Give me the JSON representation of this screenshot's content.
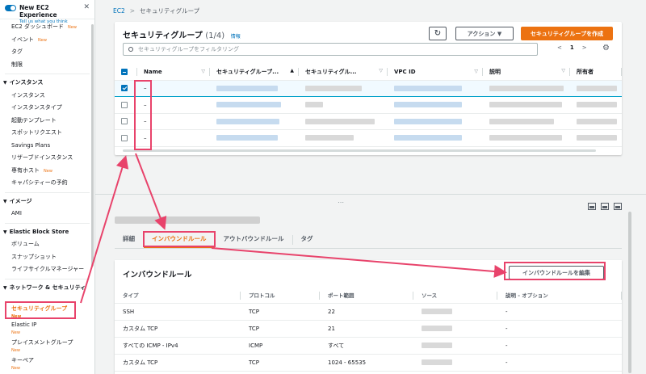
{
  "sidebar": {
    "experience_title": "New EC2 Experience",
    "experience_sub": "Tell us what you think",
    "close_glyph": "✕",
    "top_items": [
      {
        "label": "EC2 ダッシュボード",
        "badge": "New"
      },
      {
        "label": "イベント",
        "badge": "New"
      },
      {
        "label": "タグ",
        "badge": ""
      },
      {
        "label": "制限",
        "badge": ""
      }
    ],
    "sec_instances": "インスタンス",
    "instance_items": [
      {
        "label": "インスタンス",
        "badge": ""
      },
      {
        "label": "インスタンスタイプ",
        "badge": ""
      },
      {
        "label": "起動テンプレート",
        "badge": ""
      },
      {
        "label": "スポットリクエスト",
        "badge": ""
      },
      {
        "label": "Savings Plans",
        "badge": ""
      },
      {
        "label": "リザーブドインスタンス",
        "badge": ""
      },
      {
        "label": "専有ホスト",
        "badge": "New"
      },
      {
        "label": "キャパシティーの予約",
        "badge": ""
      }
    ],
    "sec_images": "イメージ",
    "image_items": [
      {
        "label": "AMI",
        "badge": ""
      }
    ],
    "sec_ebs": "Elastic Block Store",
    "ebs_items": [
      {
        "label": "ボリューム",
        "badge": ""
      },
      {
        "label": "スナップショット",
        "badge": ""
      },
      {
        "label": "ライフサイクルマネージャー",
        "badge": ""
      }
    ],
    "sec_network": "ネットワーク & セキュリティ",
    "active_item": {
      "label": "セキュリティグループ",
      "badge": "New"
    },
    "network_items": [
      {
        "label": "Elastic IP",
        "badge": "New"
      },
      {
        "label": "プレイスメントグループ",
        "badge": "New"
      },
      {
        "label": "キーペア",
        "badge": "New"
      }
    ]
  },
  "breadcrumb": {
    "root": "EC2",
    "sep": ">",
    "current": "セキュリティグループ"
  },
  "sg_panel": {
    "title": "セキュリティグループ",
    "count": "(1/4)",
    "info": "情報",
    "refresh_glyph": "↻",
    "actions_label": "アクション ▼",
    "create_label": "セキュリティグループを作成",
    "search_placeholder": "セキュリティグループをフィルタリング",
    "page": "1",
    "prev_glyph": "<",
    "next_glyph": ">",
    "settings_glyph": "⚙",
    "columns": [
      "Name",
      "セキュリティグループ...",
      "セキュリティグル...",
      "VPC ID",
      "説明",
      "所有者"
    ],
    "sort_glyph": "▲",
    "filter_glyph": "▽",
    "rows": [
      {
        "name": "–"
      },
      {
        "name": "–"
      },
      {
        "name": "–"
      },
      {
        "name": "–"
      }
    ]
  },
  "detail": {
    "split_handle": "⋯",
    "tabs": [
      "詳細",
      "インバウンドルール",
      "アウトバウンドルール",
      "タグ"
    ],
    "inbound_title": "インバウンドルール",
    "edit_label": "インバウンドルールを編集",
    "columns": [
      "タイプ",
      "プロトコル",
      "ポート範囲",
      "ソース",
      "説明 - オプション"
    ],
    "rules": [
      {
        "type": "SSH",
        "protocol": "TCP",
        "port": "22",
        "desc": "-"
      },
      {
        "type": "カスタム TCP",
        "protocol": "TCP",
        "port": "21",
        "desc": "-"
      },
      {
        "type": "すべての ICMP - IPv4",
        "protocol": "ICMP",
        "port": "すべて",
        "desc": "-"
      },
      {
        "type": "カスタム TCP",
        "protocol": "TCP",
        "port": "1024 - 65535",
        "desc": "-"
      }
    ]
  },
  "colors": {
    "accent": "#ec7211",
    "link": "#0073bb",
    "annotation": "#e8436b"
  }
}
